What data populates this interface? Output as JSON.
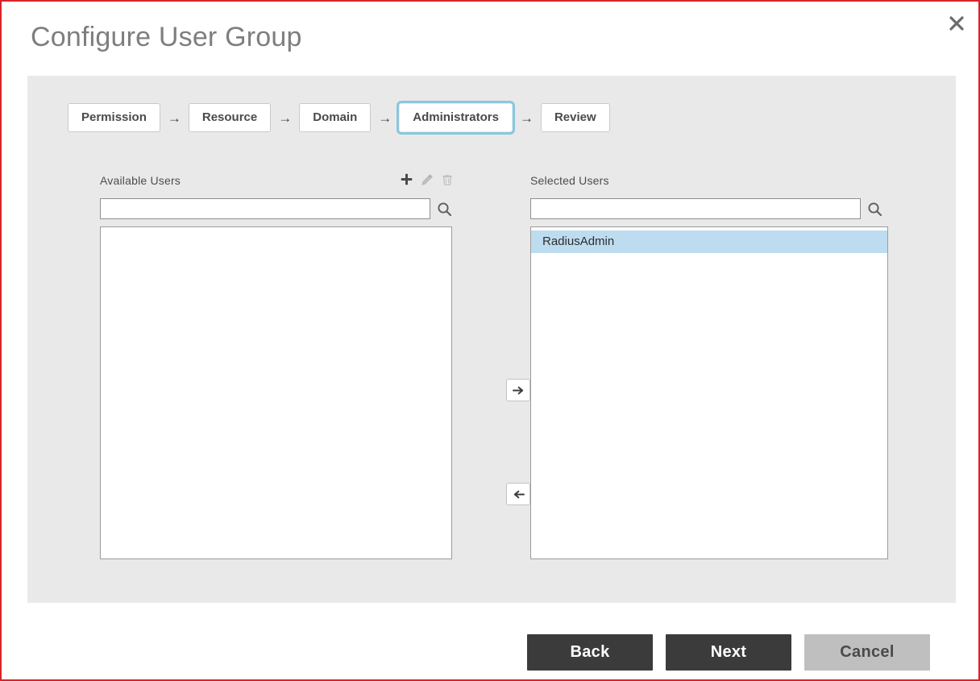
{
  "dialog": {
    "title": "Configure User Group",
    "close_icon": "close-icon"
  },
  "wizard": {
    "steps": [
      {
        "label": "Permission",
        "active": false
      },
      {
        "label": "Resource",
        "active": false
      },
      {
        "label": "Domain",
        "active": false
      },
      {
        "label": "Administrators",
        "active": true
      },
      {
        "label": "Review",
        "active": false
      }
    ],
    "separator": "→",
    "active_outline_color": "#8cc6db"
  },
  "available": {
    "title": "Available Users",
    "icons": [
      {
        "name": "add-icon",
        "label": "Add",
        "enabled": true
      },
      {
        "name": "edit-icon",
        "label": "Edit",
        "enabled": false
      },
      {
        "name": "delete-icon",
        "label": "Delete",
        "enabled": false
      }
    ],
    "search": {
      "value": "",
      "placeholder": "",
      "icon": "search-icon"
    },
    "items": []
  },
  "selected": {
    "title": "Selected Users",
    "search": {
      "value": "",
      "placeholder": "",
      "icon": "search-icon"
    },
    "items": [
      {
        "label": "RadiusAdmin",
        "selected": true
      }
    ],
    "highlight_color": "#bddcf0"
  },
  "transfer": {
    "to_selected": {
      "name": "move-right-button",
      "icon": "arrow-right-icon"
    },
    "to_available": {
      "name": "move-left-button",
      "icon": "arrow-left-icon"
    }
  },
  "footer": {
    "back_label": "Back",
    "next_label": "Next",
    "cancel_label": "Cancel",
    "primary_color": "#3b3b3b",
    "cancel_color": "#bfbfbf"
  },
  "theme": {
    "border_color": "#d8232a",
    "panel_bg": "#e9e9e9",
    "title_color": "#7e7e7e"
  }
}
